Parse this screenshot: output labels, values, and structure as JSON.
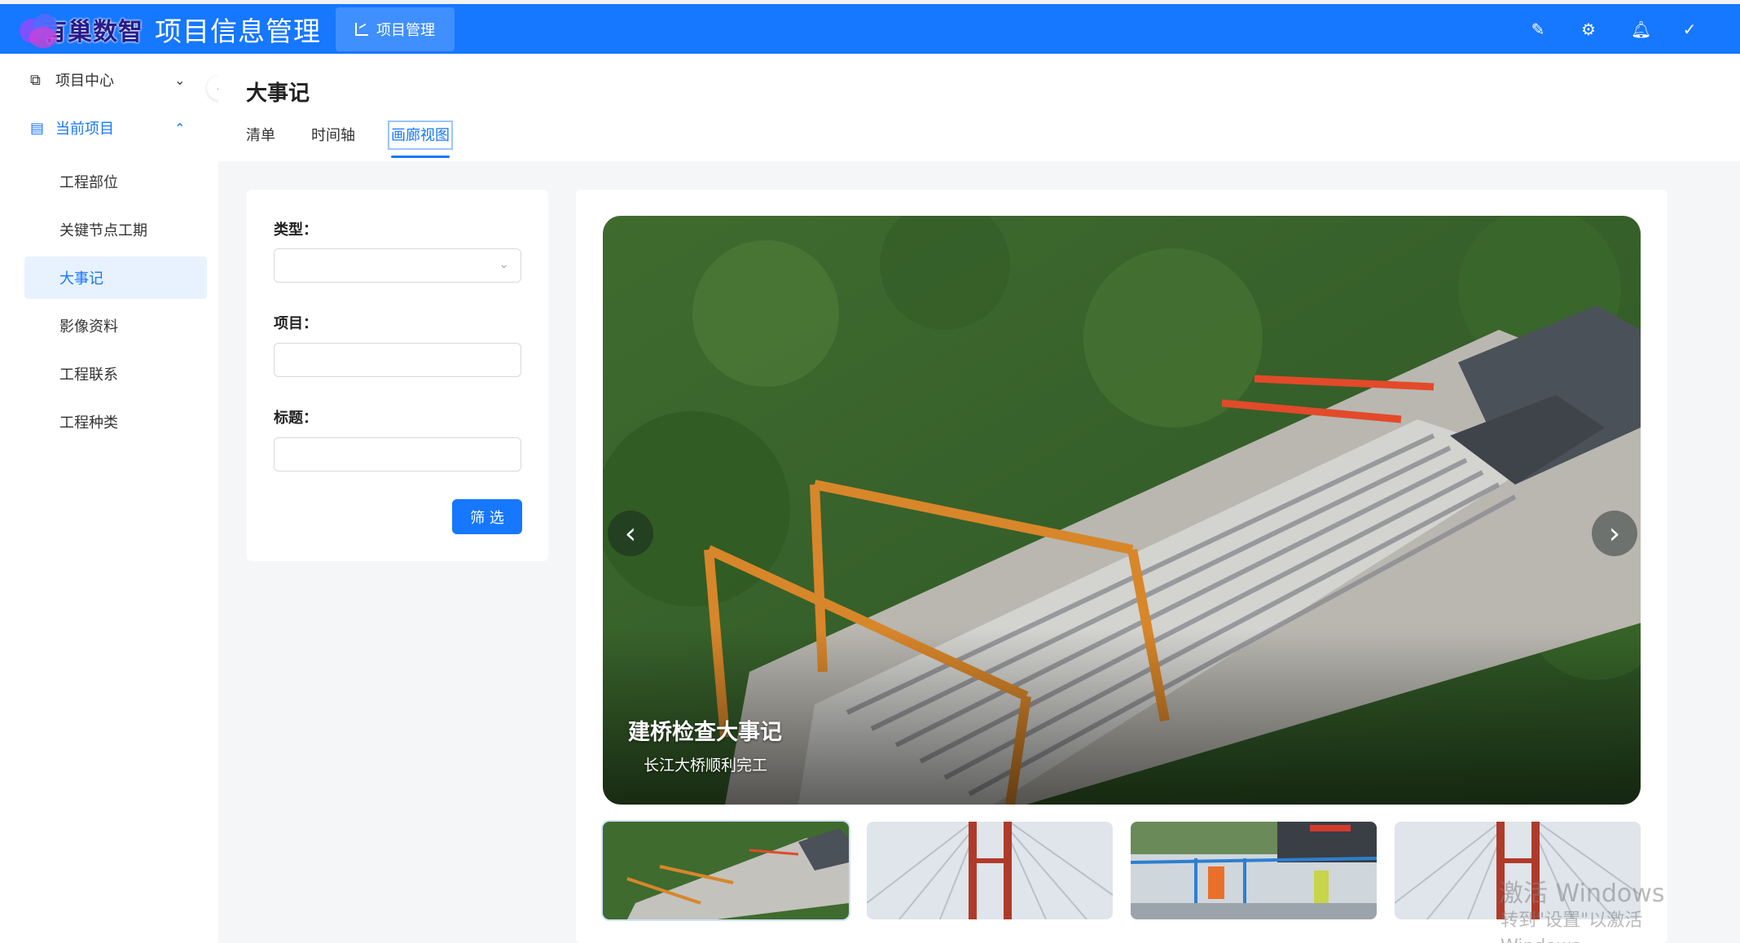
{
  "header": {
    "brand": "有巢数智",
    "app_title": "项目信息管理",
    "module_tab": "项目管理",
    "icons": [
      "pen-icon",
      "settings-icon",
      "bell-icon",
      "check-circle-icon"
    ]
  },
  "sidebar": {
    "groups": [
      {
        "label": "项目中心",
        "expanded": false
      },
      {
        "label": "当前项目",
        "expanded": true
      }
    ],
    "items": [
      {
        "label": "工程部位"
      },
      {
        "label": "关键节点工期"
      },
      {
        "label": "大事记",
        "active": true
      },
      {
        "label": "影像资料"
      },
      {
        "label": "工程联系"
      },
      {
        "label": "工程种类"
      }
    ]
  },
  "page": {
    "title": "大事记",
    "tabs": [
      {
        "label": "清单"
      },
      {
        "label": "时间轴"
      },
      {
        "label": "画廊视图",
        "active": true
      }
    ]
  },
  "filter": {
    "type_label": "类型：",
    "type_value": "",
    "project_label": "项目：",
    "project_value": "",
    "title_label": "标题：",
    "title_value": "",
    "button_label": "筛 选"
  },
  "gallery": {
    "caption_title": "建桥检查大事记",
    "caption_subtitle": "长江大桥顺利完工",
    "active_index": 0,
    "thumbnail_count": 4
  },
  "watermark": {
    "line1": "激活 Windows",
    "line2": "转到\"设置\"以激活 Windows。"
  },
  "colors": {
    "primary": "#1677ff",
    "active_bg": "#e8f2ff"
  }
}
